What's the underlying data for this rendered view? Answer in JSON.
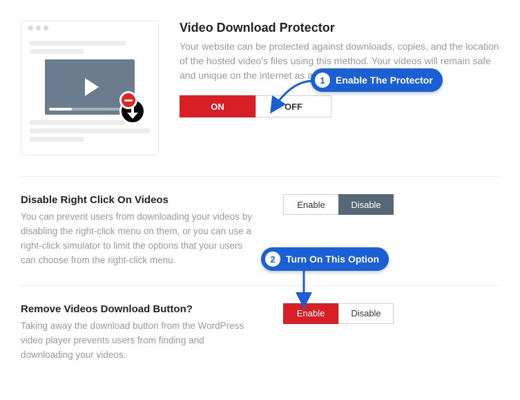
{
  "section1": {
    "title": "Video Download Protector",
    "desc": "Your website can be protected against downloads, copies, and the location of the hosted video's files using this method. Your videos will remain safe and unique on the internet as a result.",
    "on_label": "ON",
    "off_label": "OFF"
  },
  "section2": {
    "title": "Disable Right Click On Videos",
    "desc": "You can prevent users from downloading your videos by disabling the right-click menu on them, or you can use a right-click simulator to limit the options that your users can choose from the right-click menu.",
    "enable_label": "Enable",
    "disable_label": "Disable"
  },
  "section3": {
    "title": "Remove Videos Download Button?",
    "desc": "Taking away the download button from the WordPress video player prevents users from finding and downloading your videos.",
    "enable_label": "Enable",
    "disable_label": "Disable"
  },
  "callouts": {
    "c1_num": "1",
    "c1_text": "Enable The Protector",
    "c2_num": "2",
    "c2_text": "Turn On This Option"
  }
}
